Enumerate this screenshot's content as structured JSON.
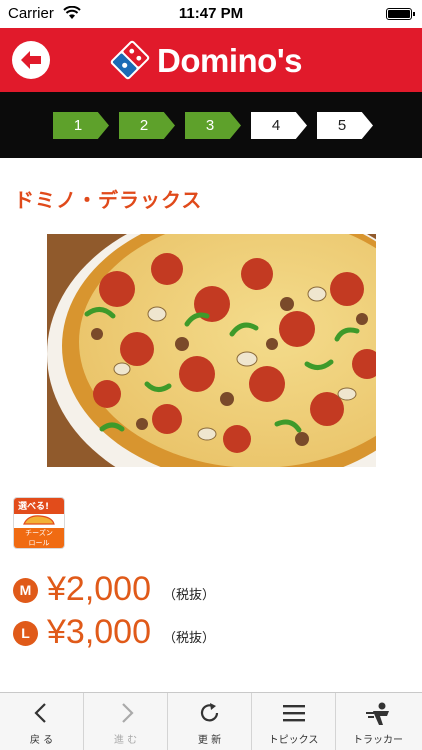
{
  "status_bar": {
    "carrier": "Carrier",
    "time": "11:47 PM"
  },
  "header": {
    "brand": "Domino's"
  },
  "steps": [
    "1",
    "2",
    "3",
    "4",
    "5"
  ],
  "steps_completed": 3,
  "product": {
    "name": "ドミノ・デラックス",
    "badge": {
      "top": "選べる!",
      "bottom_line1": "チーズン",
      "bottom_line2": "ロール"
    },
    "prices": [
      {
        "size": "M",
        "price": "¥2,000",
        "tax": "（税抜）"
      },
      {
        "size": "L",
        "price": "¥3,000",
        "tax": "（税抜）"
      }
    ]
  },
  "toolbar": {
    "items": [
      {
        "label": "戻 る",
        "icon": "chevron-left-icon"
      },
      {
        "label": "進 む",
        "icon": "chevron-right-icon"
      },
      {
        "label": "更 新",
        "icon": "refresh-icon"
      },
      {
        "label": "トピックス",
        "icon": "menu-icon"
      },
      {
        "label": "トラッカー",
        "icon": "delivery-person-icon"
      }
    ]
  },
  "colors": {
    "brand_red": "#e11a2b",
    "accent_orange": "#e05a19",
    "step_green": "#5ea12b",
    "domino_blue": "#1b6bb5"
  }
}
